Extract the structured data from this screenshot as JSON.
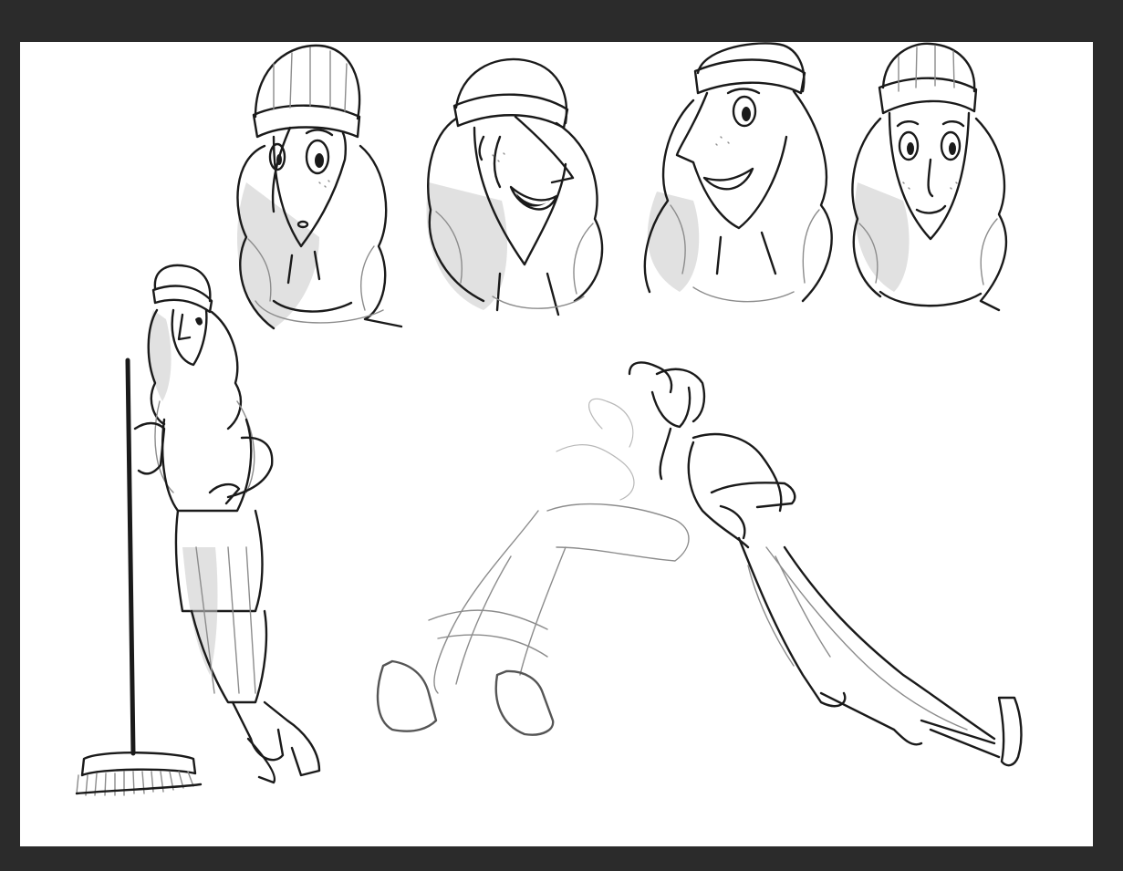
{
  "background_color": "#2b2b2b",
  "paper_color": "#ffffff",
  "ink_color": "#1a1a1a",
  "pencil_color": "#8c8c8c",
  "sketches": [
    {
      "name": "head-sad"
    },
    {
      "name": "head-laughing"
    },
    {
      "name": "head-smirk"
    },
    {
      "name": "head-neutral"
    },
    {
      "name": "figure-leaning-on-broom"
    },
    {
      "name": "figures-dancing-pair"
    }
  ]
}
